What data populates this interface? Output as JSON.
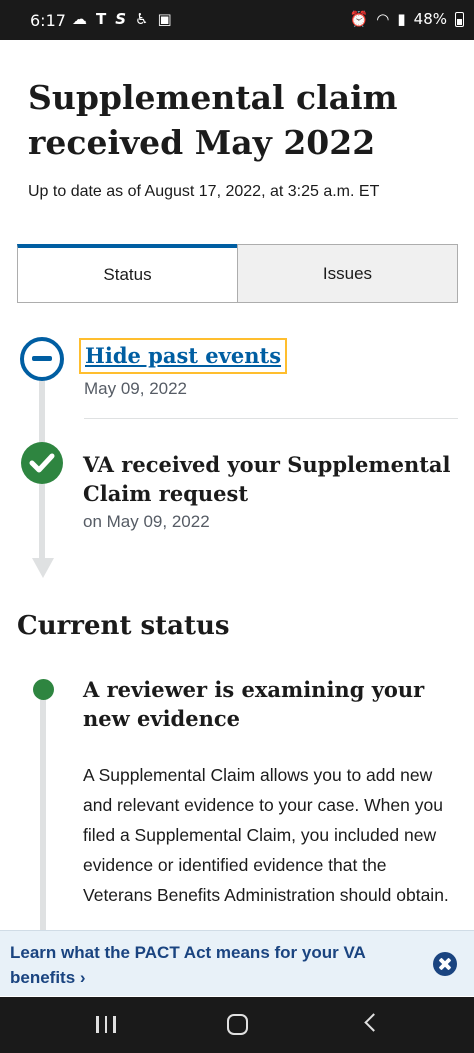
{
  "status_bar": {
    "time": "6:17",
    "battery": "48%",
    "left_icons": [
      "cloud-icon",
      "t-mobile-icon",
      "s-app-icon",
      "accessibility-icon",
      "photo-icon"
    ],
    "right_icons": [
      "alarm-icon",
      "wifi-icon",
      "signal-icon",
      "battery-icon"
    ]
  },
  "page": {
    "title": "Supplemental claim received May 2022",
    "updated": "Up to date as of August 17, 2022, at 3:25 a.m. ET"
  },
  "tabs": [
    {
      "label": "Status",
      "active": true
    },
    {
      "label": "Issues",
      "active": false
    }
  ],
  "timeline": {
    "hide_link": "Hide past events",
    "hide_date": "May 09, 2022",
    "events": [
      {
        "title": "VA received your Supplemental Claim request",
        "date": "on May 09, 2022"
      }
    ]
  },
  "current_status": {
    "heading": "Current status",
    "title": "A reviewer is examining your new evidence",
    "body": "A Supplemental Claim allows you to add new and relevant evidence to your case. When you filed a Supplemental Claim, you included new evidence or identified evidence that the Veterans Benefits Administration should obtain."
  },
  "banner": {
    "text": "Learn what the PACT Act means for your VA benefits ›",
    "close_icon": "close-icon"
  },
  "colors": {
    "primary": "#005ea2",
    "success": "#2e8540",
    "focus": "#ffbe2e",
    "banner_bg": "#e8f1f8",
    "banner_text": "#1a4480"
  }
}
